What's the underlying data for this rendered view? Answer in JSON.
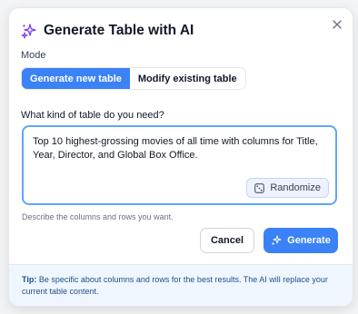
{
  "dialog": {
    "title": "Generate Table with AI",
    "close_icon": "close-icon",
    "title_icon": "sparkles-icon"
  },
  "mode": {
    "label": "Mode",
    "options": [
      "Generate new table",
      "Modify existing table"
    ],
    "selected": "Generate new table"
  },
  "prompt": {
    "label": "What kind of table do you need?",
    "value": "Top 10 highest-grossing movies of all time with columns for Title, Year, Director, and Global Box Office.",
    "hint": "Describe the columns and rows you want.",
    "randomize_label": "Randomize",
    "randomize_icon": "dice-icon"
  },
  "actions": {
    "cancel_label": "Cancel",
    "generate_label": "Generate",
    "generate_icon": "sparkles-icon"
  },
  "tip": {
    "prefix": "Tip:",
    "text": " Be specific about columns and rows for the best results. The AI will replace your current table content."
  },
  "colors": {
    "accent": "#3b82f6",
    "icon_purple": "#7c3aed"
  }
}
